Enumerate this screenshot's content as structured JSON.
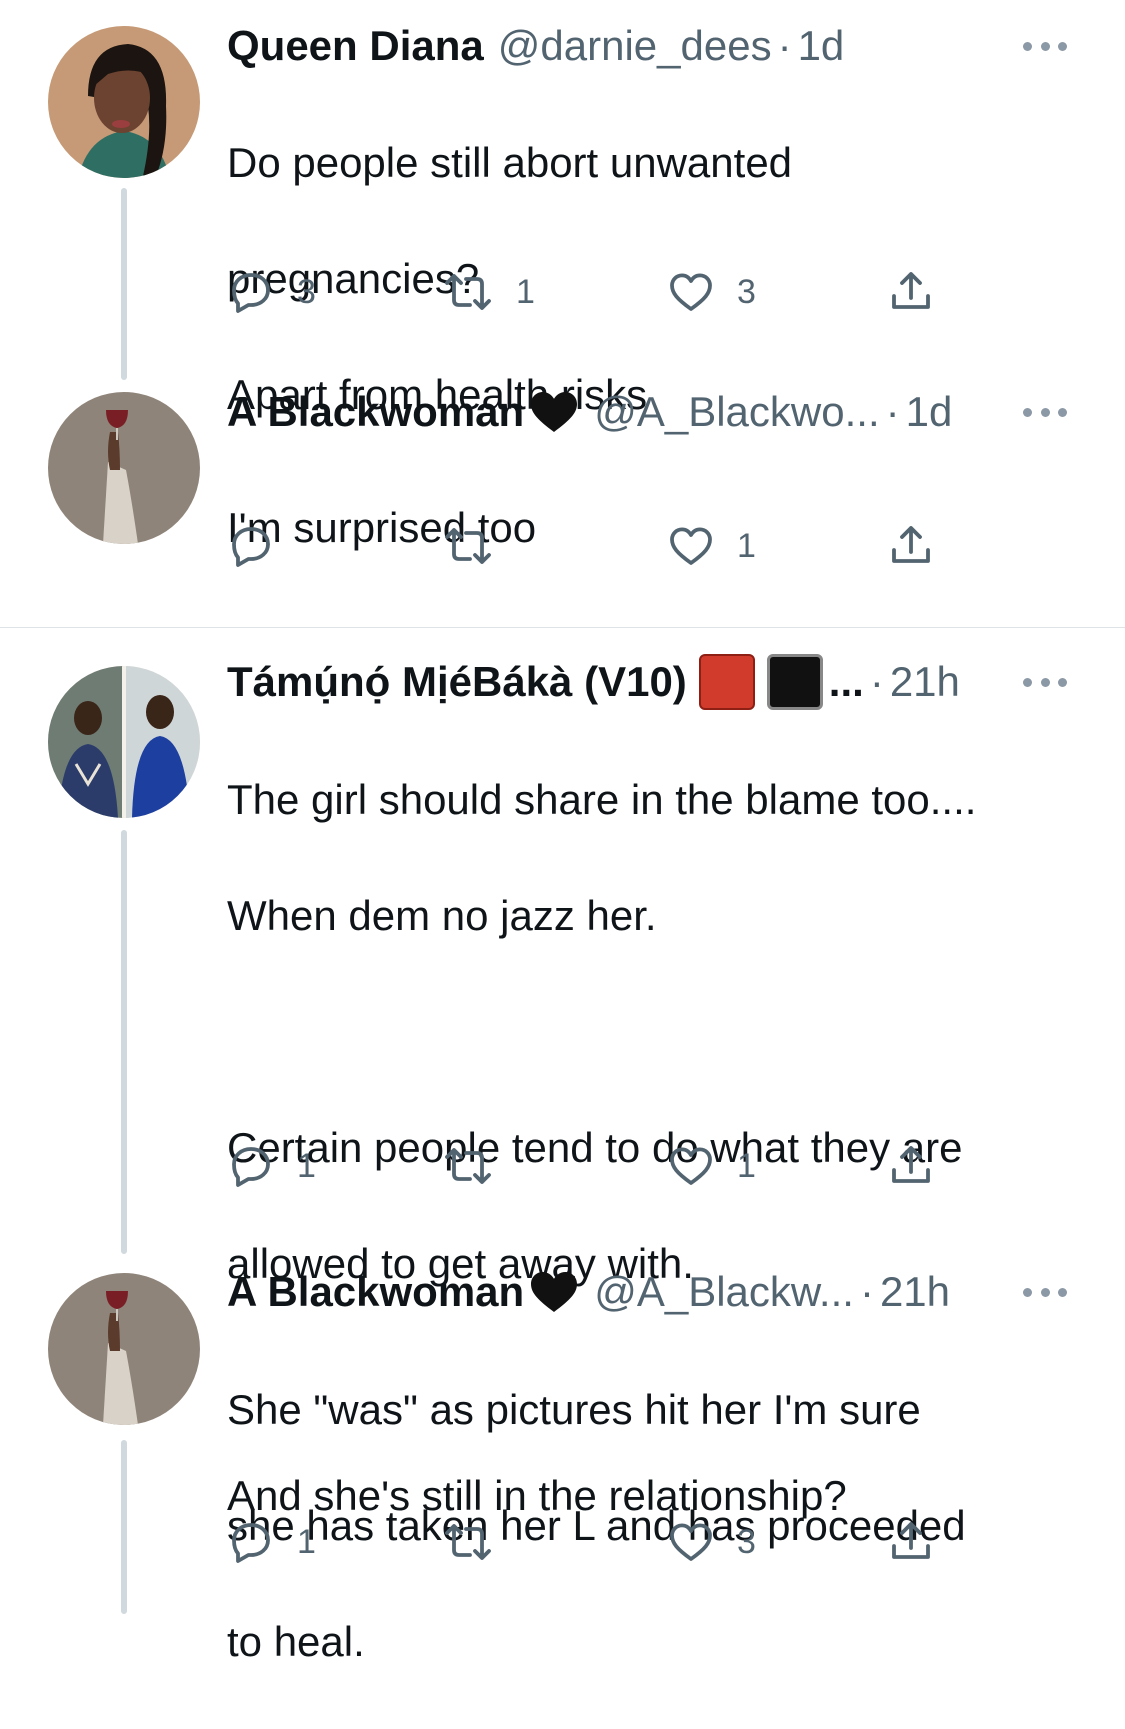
{
  "tweets": [
    {
      "name": "Queen Diana",
      "handle": "@darnie_dees",
      "time": "1d",
      "lines": [
        "Do people still abort unwanted",
        "pregnancies?",
        "Apart from health risks"
      ],
      "replies": "3",
      "retweets": "1",
      "likes": "3"
    },
    {
      "name": "A Blackwoman",
      "name_emoji": "black-heart-icon",
      "handle": "@A_Blackwo...",
      "time": "1d",
      "lines": [
        "I'm surprised too"
      ],
      "replies": "",
      "retweets": "",
      "likes": "1"
    },
    {
      "name": "Támụ́nọ́ MịéBákà (V10)",
      "name_emoji": "red-square-icon black-square-icon",
      "name_truncation": "...",
      "time": "21h",
      "lines": [
        "The girl should share in the blame too....",
        "When dem no jazz her.",
        "",
        "Certain people tend to do what they are",
        "allowed to get away with.",
        "",
        "And she's still in the relationship?"
      ],
      "replies": "1",
      "retweets": "",
      "likes": "1"
    },
    {
      "name": "A Blackwoman",
      "name_emoji": "black-heart-icon",
      "handle": "@A_Blackw...",
      "time": "21h",
      "lines": [
        "She \"was\" as pictures hit her I'm sure",
        "she has taken her L and has proceeded",
        "to heal."
      ],
      "replies": "1",
      "retweets": "",
      "likes": "3"
    }
  ],
  "separator": "·",
  "colors": {
    "text": "#0f1419",
    "secondary": "#536471",
    "thread_line": "#cfd9de",
    "divider": "#dfe3e6"
  }
}
